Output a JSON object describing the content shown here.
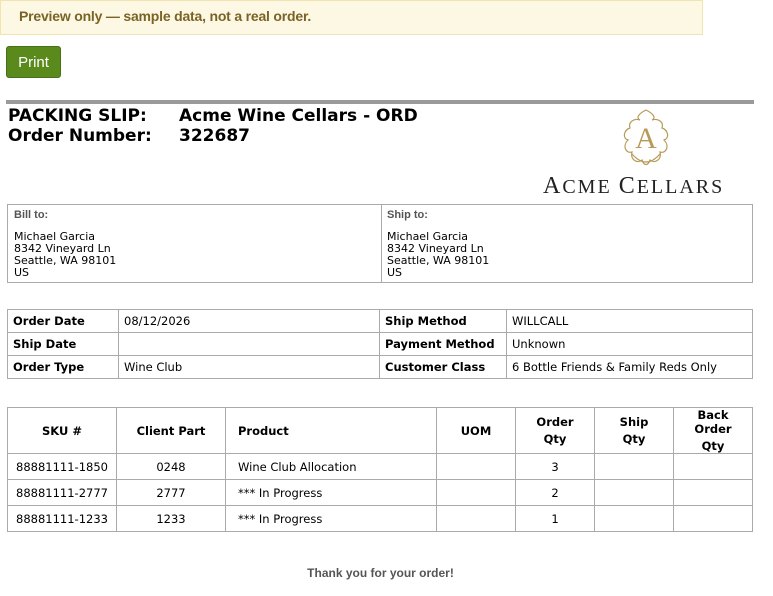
{
  "notice": "Preview only — sample data, not a real order.",
  "print_label": "Print",
  "header": {
    "packing_slip_label": "PACKING SLIP:",
    "order_number_label": "Order Number:",
    "company": "Acme Wine Cellars - ORD",
    "order_number": "322687"
  },
  "logo": {
    "monogram": "A",
    "text_first": "A",
    "text_rest1": "CME ",
    "text_first2": "C",
    "text_rest2": "ELLARS"
  },
  "bill_to": {
    "label": "Bill to:",
    "lines": [
      "Michael Garcia",
      "8342 Vineyard Ln",
      "Seattle, WA 98101",
      "US"
    ]
  },
  "ship_to": {
    "label": "Ship to:",
    "lines": [
      "Michael Garcia",
      "8342 Vineyard Ln",
      "Seattle, WA 98101",
      "US"
    ]
  },
  "order_info": [
    {
      "k1": "Order Date",
      "v1": "08/12/2026",
      "k2": "Ship Method",
      "v2": "WILLCALL"
    },
    {
      "k1": "Ship Date",
      "v1": "",
      "k2": "Payment Method",
      "v2": "Unknown"
    },
    {
      "k1": "Order Type",
      "v1": "Wine Club",
      "k2": "Customer Class",
      "v2": "6 Bottle Friends & Family Reds Only"
    }
  ],
  "items": {
    "headers": {
      "sku": "SKU #",
      "client_part": "Client Part",
      "product": "Product",
      "uom": "UOM",
      "order_qty_1": "Order",
      "order_qty_2": "Qty",
      "ship_qty_1": "Ship",
      "ship_qty_2": "Qty",
      "back_qty_1": "Back Order",
      "back_qty_2": "Qty"
    },
    "rows": [
      {
        "sku": "88881111-1850",
        "client_part": "0248",
        "product": "Wine Club Allocation",
        "uom": "",
        "order_qty": "3",
        "ship_qty": "",
        "back_qty": ""
      },
      {
        "sku": "88881111-2777",
        "client_part": "2777",
        "product": "*** In Progress",
        "uom": "",
        "order_qty": "2",
        "ship_qty": "",
        "back_qty": ""
      },
      {
        "sku": "88881111-1233",
        "client_part": "1233",
        "product": "*** In Progress",
        "uom": "",
        "order_qty": "1",
        "ship_qty": "",
        "back_qty": ""
      }
    ]
  },
  "footer": "Thank you for your order!",
  "colors": {
    "print_button": "#5b8a1c",
    "notice_bg": "#fcf8e3",
    "notice_text": "#7a6425",
    "logo_gold": "#b89a5a"
  }
}
